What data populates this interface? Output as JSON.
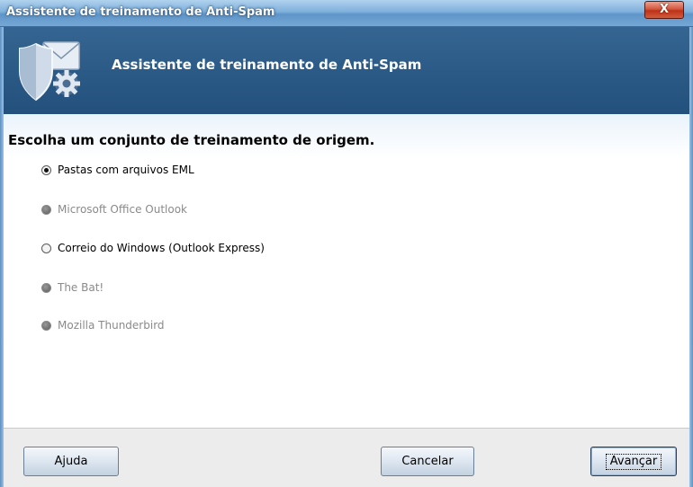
{
  "window": {
    "title": "Assistente de treinamento de Anti-Spam",
    "close_label": "X"
  },
  "header": {
    "title": "Assistente de treinamento de Anti-Spam",
    "icon": "shield-envelope-gear-icon"
  },
  "main": {
    "heading": "Escolha um conjunto de treinamento de origem.",
    "options": [
      {
        "label": "Pastas com arquivos EML",
        "checked": true,
        "enabled": true
      },
      {
        "label": "Microsoft Office Outlook",
        "checked": false,
        "enabled": false
      },
      {
        "label": "Correio do Windows (Outlook Express)",
        "checked": false,
        "enabled": true
      },
      {
        "label": "The Bat!",
        "checked": false,
        "enabled": false
      },
      {
        "label": "Mozilla Thunderbird",
        "checked": false,
        "enabled": false
      }
    ]
  },
  "footer": {
    "help_label": "Ajuda",
    "cancel_label": "Cancelar",
    "next_label": "Avançar"
  },
  "colors": {
    "header_bg": "#2a5884",
    "titlebar": "#6fa3d4",
    "close_button": "#c8452a"
  }
}
